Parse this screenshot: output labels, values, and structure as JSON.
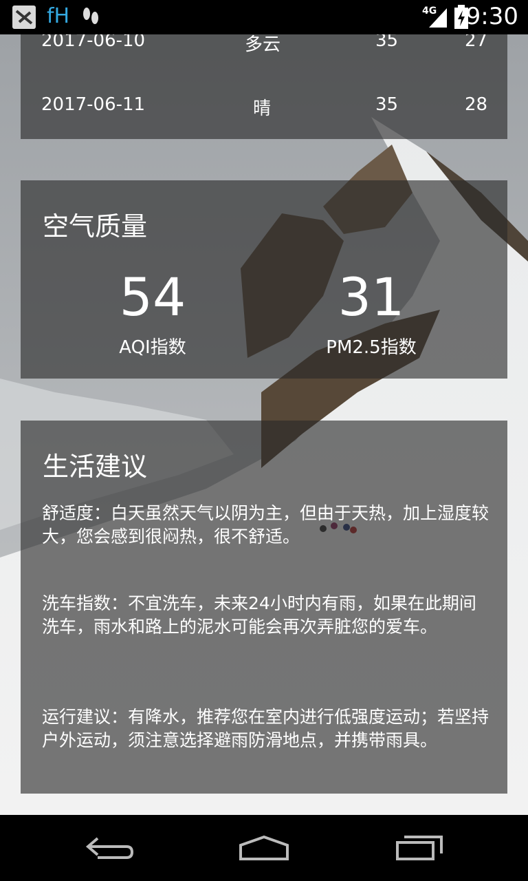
{
  "status_bar": {
    "app_text": "fH",
    "network": "4G",
    "time": "9:30"
  },
  "forecast": {
    "rows": [
      {
        "date": "2017-06-10",
        "cond": "多云",
        "max": "35",
        "min": "27"
      },
      {
        "date": "2017-06-11",
        "cond": "晴",
        "max": "35",
        "min": "28"
      }
    ]
  },
  "aqi": {
    "title": "空气质量",
    "aqi_value": "54",
    "aqi_label": "AQI指数",
    "pm25_value": "31",
    "pm25_label": "PM2.5指数"
  },
  "suggestion": {
    "title": "生活建议",
    "comfort": "舒适度：白天虽然天气以阴为主，但由于天热，加上湿度较大，您会感到很闷热，很不舒适。",
    "car_wash": "洗车指数：不宜洗车，未来24小时内有雨，如果在此期间洗车，雨水和路上的泥水可能会再次弄脏您的爱车。",
    "sport": "运行建议：有降水，推荐您在室内进行低强度运动；若坚持户外运动，须注意选择避雨防滑地点，并携带雨具。"
  },
  "nav": {
    "back_icon": "back-icon",
    "home_icon": "home-icon",
    "recents_icon": "recents-icon"
  }
}
